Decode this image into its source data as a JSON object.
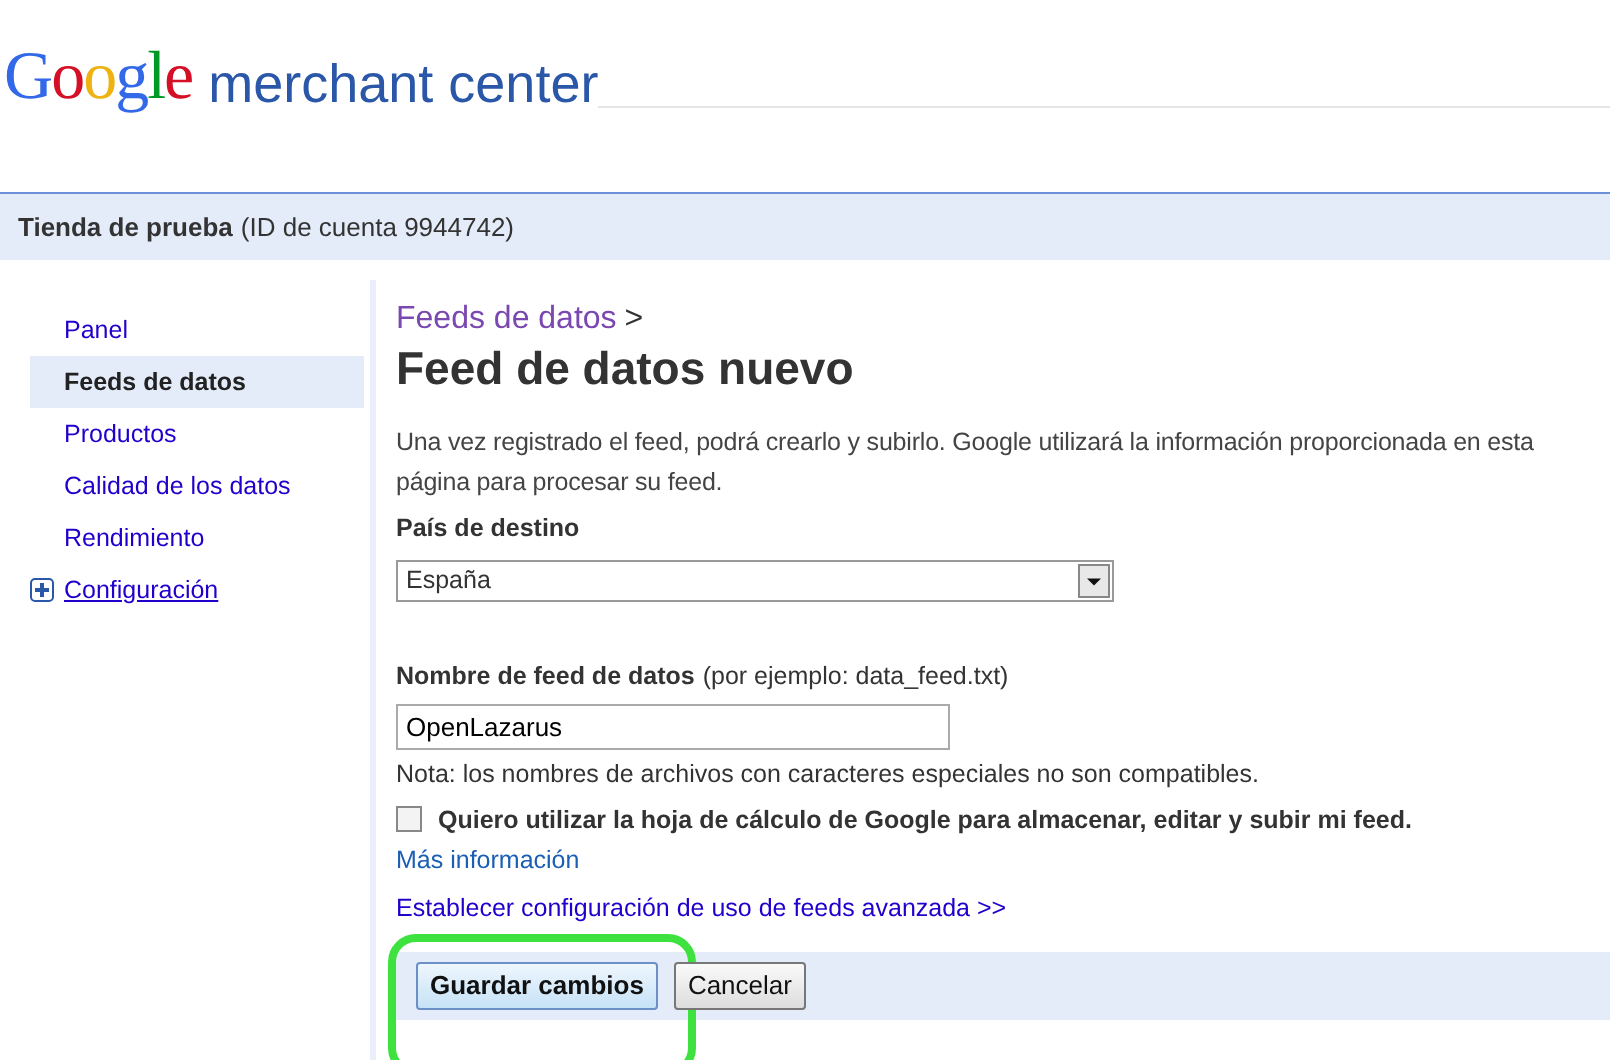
{
  "header": {
    "logo": "Google",
    "product": "merchant center"
  },
  "account_bar": {
    "store": "Tienda de prueba",
    "account_id": "(ID de cuenta 9944742)"
  },
  "sidebar": {
    "items": [
      {
        "label": "Panel",
        "selected": false,
        "kind": "link"
      },
      {
        "label": "Feeds de datos",
        "selected": true,
        "kind": "link"
      },
      {
        "label": "Productos",
        "selected": false,
        "kind": "link"
      },
      {
        "label": "Calidad de los datos",
        "selected": false,
        "kind": "link"
      },
      {
        "label": "Rendimiento",
        "selected": false,
        "kind": "link"
      },
      {
        "label": "Configuración",
        "selected": false,
        "kind": "expandable",
        "expanded": false
      }
    ]
  },
  "breadcrumb": {
    "link": "Feeds de datos",
    "separator": ">"
  },
  "page_title": "Feed de datos nuevo",
  "intro": "Una vez registrado el feed, podrá crearlo y subirlo. Google utilizará la información proporcionada en esta página para procesar su feed.",
  "country": {
    "label": "País de destino",
    "value": "España"
  },
  "feed_name": {
    "label": "Nombre de feed de datos",
    "hint": "(por ejemplo: data_feed.txt)",
    "value": "OpenLazarus",
    "note": "Nota: los nombres de archivos con caracteres especiales no son compatibles."
  },
  "spreadsheet": {
    "label": "Quiero utilizar la hoja de cálculo de Google para almacenar, editar y subir mi feed.",
    "checked": false
  },
  "links": [
    "Más información",
    "Establecer configuración de uso de feeds avanzada >>"
  ],
  "buttons": [
    {
      "label": "Guardar cambios",
      "kind": "primary",
      "highlighted": true
    },
    {
      "label": "Cancelar",
      "kind": "secondary",
      "highlighted": false
    }
  ]
}
